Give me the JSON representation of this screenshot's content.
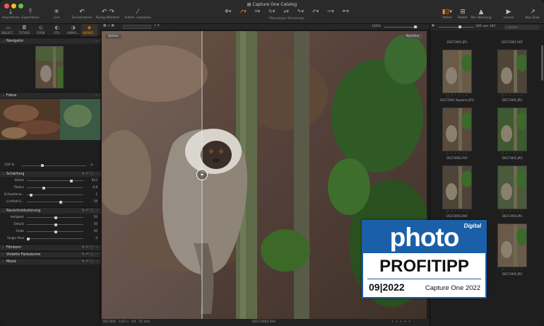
{
  "window": {
    "title": "Capture One Catalog"
  },
  "toolbar": {
    "import": "Importieren",
    "export": "Exportieren",
    "live": "Live",
    "reset": "Zurücksetzen",
    "history": "Rückg./Wiederh.",
    "auto": "Autom. anpassen",
    "cursor_tools_label": "Mauszeiger Werkzeuge",
    "proof": "Vorher",
    "grid": "Raster",
    "warning": "Bel.-Warnung",
    "learn": "Lernen",
    "copy": "Kop./Zuw."
  },
  "tabs": [
    {
      "label": "BIBLIOT..."
    },
    {
      "label": "TETHER"
    },
    {
      "label": "FORM"
    },
    {
      "label": "STIL"
    },
    {
      "label": "ANPAS..."
    },
    {
      "label": "WERKZ..."
    }
  ],
  "panels": {
    "navigator": "Navigator",
    "focus": "Fokus",
    "focus_zoom": "100 %",
    "sharpening": {
      "title": "Schärfung",
      "rows": [
        {
          "label": "Stärke",
          "value": "B12",
          "pos": 0.78
        },
        {
          "label": "Radius",
          "value": "0,8",
          "pos": 0.28
        },
        {
          "label": "Schwellenw...",
          "value": "1",
          "pos": 0.05
        },
        {
          "label": "Lichthof-U...",
          "value": "59",
          "pos": 0.59
        }
      ]
    },
    "noise": {
      "title": "Rauschreduzierung",
      "rows": [
        {
          "label": "Helligkeit",
          "value": "50",
          "pos": 0.5
        },
        {
          "label": "Details",
          "value": "50",
          "pos": 0.5
        },
        {
          "label": "Farbe",
          "value": "50",
          "pos": 0.5
        },
        {
          "label": "Single Pixel",
          "value": "0",
          "pos": 0.0
        }
      ]
    },
    "collapsed": [
      "Filmkorn",
      "Violette Farbsäume",
      "Moiré"
    ]
  },
  "viewer": {
    "zoom": "100%",
    "left_label": "Vorher",
    "right_label": "Nachher",
    "filename": "DSCF3902.RAF",
    "exif": [
      "ISO 800",
      "1/15 s",
      "f/4",
      "55 mm"
    ]
  },
  "browser": {
    "count": "185 von 185",
    "search_placeholder": "Suche",
    "files": [
      "DSCF3901.JPG",
      "DSCF3901.RAF",
      "DSCF3901 Kopieren.JPG",
      "DSCF3902.JPG",
      "DSCF3902.RAF",
      "DSCF3903.JPG",
      "DSCF3903.RAF",
      "DSCF3904.JPG",
      "",
      "DSCF3905.JPG"
    ]
  },
  "badge": {
    "brand_small": "Digital",
    "brand": "photo",
    "headline": "PROFITIPP",
    "issue": "09|2022",
    "product": "Capture One 2022"
  },
  "colors": {
    "accent": "#e08a2a",
    "badge_blue": "#1a5fa8"
  }
}
